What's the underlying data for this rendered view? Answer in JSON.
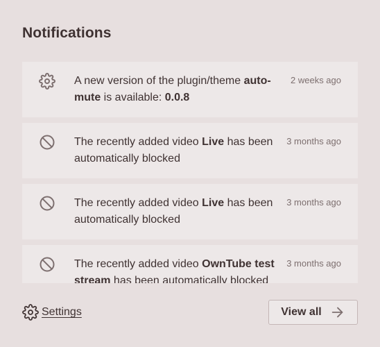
{
  "header": {
    "title": "Notifications"
  },
  "notifications": [
    {
      "icon": "gear-icon",
      "text_before": "A new version of the plugin/theme ",
      "bold": "auto-mute",
      "text_middle": " is available: ",
      "bold2": "0.0.8",
      "text_after": "",
      "time": "2 weeks ago"
    },
    {
      "icon": "blocked-icon",
      "text_before": "The recently added video ",
      "bold": "Live",
      "text_middle": " has been automatically blocked",
      "bold2": "",
      "text_after": "",
      "time": "3 months ago"
    },
    {
      "icon": "blocked-icon",
      "text_before": "The recently added video ",
      "bold": "Live",
      "text_middle": " has been automatically blocked",
      "bold2": "",
      "text_after": "",
      "time": "3 months ago"
    },
    {
      "icon": "blocked-icon",
      "text_before": "The recently added video ",
      "bold": "OwnTube test stream",
      "text_middle": " has been automatically blocked",
      "bold2": "",
      "text_after": "",
      "time": "3 months ago"
    }
  ],
  "footer": {
    "settings_label": "Settings",
    "view_all_label": "View all"
  }
}
